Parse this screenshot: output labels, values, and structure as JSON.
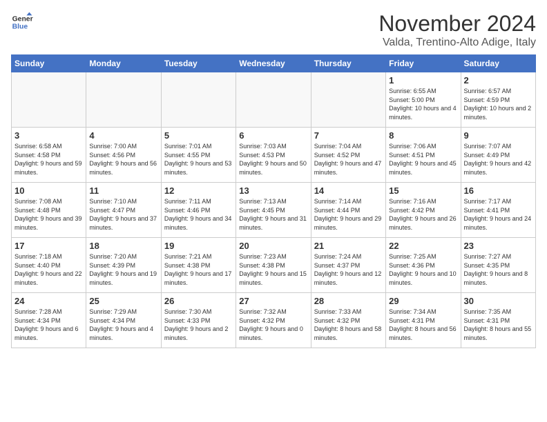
{
  "logo": {
    "line1": "General",
    "line2": "Blue"
  },
  "header": {
    "month": "November 2024",
    "location": "Valda, Trentino-Alto Adige, Italy"
  },
  "weekdays": [
    "Sunday",
    "Monday",
    "Tuesday",
    "Wednesday",
    "Thursday",
    "Friday",
    "Saturday"
  ],
  "weeks": [
    [
      {
        "day": "",
        "info": ""
      },
      {
        "day": "",
        "info": ""
      },
      {
        "day": "",
        "info": ""
      },
      {
        "day": "",
        "info": ""
      },
      {
        "day": "",
        "info": ""
      },
      {
        "day": "1",
        "info": "Sunrise: 6:55 AM\nSunset: 5:00 PM\nDaylight: 10 hours and 4 minutes."
      },
      {
        "day": "2",
        "info": "Sunrise: 6:57 AM\nSunset: 4:59 PM\nDaylight: 10 hours and 2 minutes."
      }
    ],
    [
      {
        "day": "3",
        "info": "Sunrise: 6:58 AM\nSunset: 4:58 PM\nDaylight: 9 hours and 59 minutes."
      },
      {
        "day": "4",
        "info": "Sunrise: 7:00 AM\nSunset: 4:56 PM\nDaylight: 9 hours and 56 minutes."
      },
      {
        "day": "5",
        "info": "Sunrise: 7:01 AM\nSunset: 4:55 PM\nDaylight: 9 hours and 53 minutes."
      },
      {
        "day": "6",
        "info": "Sunrise: 7:03 AM\nSunset: 4:53 PM\nDaylight: 9 hours and 50 minutes."
      },
      {
        "day": "7",
        "info": "Sunrise: 7:04 AM\nSunset: 4:52 PM\nDaylight: 9 hours and 47 minutes."
      },
      {
        "day": "8",
        "info": "Sunrise: 7:06 AM\nSunset: 4:51 PM\nDaylight: 9 hours and 45 minutes."
      },
      {
        "day": "9",
        "info": "Sunrise: 7:07 AM\nSunset: 4:49 PM\nDaylight: 9 hours and 42 minutes."
      }
    ],
    [
      {
        "day": "10",
        "info": "Sunrise: 7:08 AM\nSunset: 4:48 PM\nDaylight: 9 hours and 39 minutes."
      },
      {
        "day": "11",
        "info": "Sunrise: 7:10 AM\nSunset: 4:47 PM\nDaylight: 9 hours and 37 minutes."
      },
      {
        "day": "12",
        "info": "Sunrise: 7:11 AM\nSunset: 4:46 PM\nDaylight: 9 hours and 34 minutes."
      },
      {
        "day": "13",
        "info": "Sunrise: 7:13 AM\nSunset: 4:45 PM\nDaylight: 9 hours and 31 minutes."
      },
      {
        "day": "14",
        "info": "Sunrise: 7:14 AM\nSunset: 4:44 PM\nDaylight: 9 hours and 29 minutes."
      },
      {
        "day": "15",
        "info": "Sunrise: 7:16 AM\nSunset: 4:42 PM\nDaylight: 9 hours and 26 minutes."
      },
      {
        "day": "16",
        "info": "Sunrise: 7:17 AM\nSunset: 4:41 PM\nDaylight: 9 hours and 24 minutes."
      }
    ],
    [
      {
        "day": "17",
        "info": "Sunrise: 7:18 AM\nSunset: 4:40 PM\nDaylight: 9 hours and 22 minutes."
      },
      {
        "day": "18",
        "info": "Sunrise: 7:20 AM\nSunset: 4:39 PM\nDaylight: 9 hours and 19 minutes."
      },
      {
        "day": "19",
        "info": "Sunrise: 7:21 AM\nSunset: 4:38 PM\nDaylight: 9 hours and 17 minutes."
      },
      {
        "day": "20",
        "info": "Sunrise: 7:23 AM\nSunset: 4:38 PM\nDaylight: 9 hours and 15 minutes."
      },
      {
        "day": "21",
        "info": "Sunrise: 7:24 AM\nSunset: 4:37 PM\nDaylight: 9 hours and 12 minutes."
      },
      {
        "day": "22",
        "info": "Sunrise: 7:25 AM\nSunset: 4:36 PM\nDaylight: 9 hours and 10 minutes."
      },
      {
        "day": "23",
        "info": "Sunrise: 7:27 AM\nSunset: 4:35 PM\nDaylight: 9 hours and 8 minutes."
      }
    ],
    [
      {
        "day": "24",
        "info": "Sunrise: 7:28 AM\nSunset: 4:34 PM\nDaylight: 9 hours and 6 minutes."
      },
      {
        "day": "25",
        "info": "Sunrise: 7:29 AM\nSunset: 4:34 PM\nDaylight: 9 hours and 4 minutes."
      },
      {
        "day": "26",
        "info": "Sunrise: 7:30 AM\nSunset: 4:33 PM\nDaylight: 9 hours and 2 minutes."
      },
      {
        "day": "27",
        "info": "Sunrise: 7:32 AM\nSunset: 4:32 PM\nDaylight: 9 hours and 0 minutes."
      },
      {
        "day": "28",
        "info": "Sunrise: 7:33 AM\nSunset: 4:32 PM\nDaylight: 8 hours and 58 minutes."
      },
      {
        "day": "29",
        "info": "Sunrise: 7:34 AM\nSunset: 4:31 PM\nDaylight: 8 hours and 56 minutes."
      },
      {
        "day": "30",
        "info": "Sunrise: 7:35 AM\nSunset: 4:31 PM\nDaylight: 8 hours and 55 minutes."
      }
    ]
  ]
}
